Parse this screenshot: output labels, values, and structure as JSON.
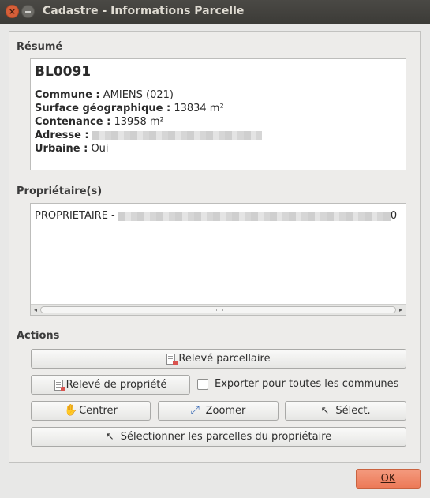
{
  "window": {
    "title": "Cadastre - Informations Parcelle",
    "close_glyph": "×"
  },
  "resume": {
    "label": "Résumé",
    "parcel_id": "BL0091",
    "commune_label": "Commune :",
    "commune_value": "AMIENS (021)",
    "surface_label": "Surface géographique :",
    "surface_value": "13834 m²",
    "contenance_label": "Contenance :",
    "contenance_value": "13958 m²",
    "adresse_label": "Adresse :",
    "urbaine_label": "Urbaine :",
    "urbaine_value": "Oui"
  },
  "owners": {
    "label": "Propriétaire(s)",
    "line_prefix": "PROPRIETAIRE -",
    "line_suffix": "0",
    "scroll_left": "◂",
    "scroll_right": "▸"
  },
  "actions": {
    "label": "Actions",
    "releve_parcellaire": "Relevé parcellaire",
    "releve_propriete": "Relevé de propriété",
    "export_all": "Exporter pour toutes les communes",
    "export_all_checked": false,
    "centrer": "Centrer",
    "zoomer": "Zoomer",
    "select": "Sélect.",
    "select_owner_parcels": "Sélectionner les parcelles du propriétaire"
  },
  "icons": {
    "hand": "✋",
    "zoom": "⤢",
    "cursor": "↖"
  },
  "dialog": {
    "ok": "OK"
  },
  "colors": {
    "ok_button": "#ec7a58",
    "titlebar": "#3c3b37",
    "close_button": "#d65f39"
  }
}
